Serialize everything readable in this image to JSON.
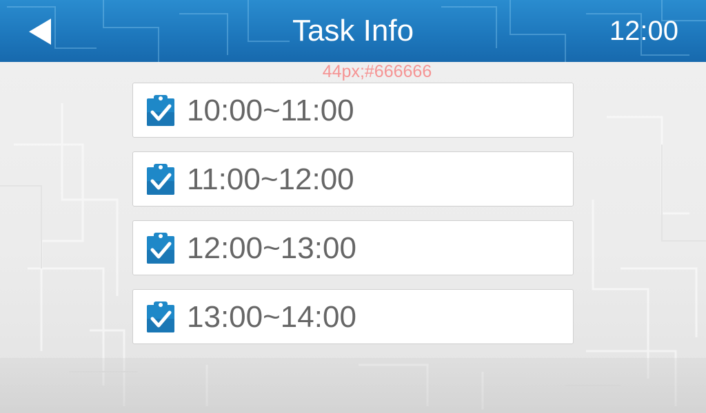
{
  "header": {
    "back_icon": "back-arrow-icon",
    "title": "Task Info",
    "clock": "12:00"
  },
  "annotation": "44px;#666666",
  "tasks": [
    {
      "label": "10:00~11:00",
      "icon": "clipboard-check-icon"
    },
    {
      "label": "11:00~12:00",
      "icon": "clipboard-check-icon"
    },
    {
      "label": "12:00~13:00",
      "icon": "clipboard-check-icon"
    },
    {
      "label": "13:00~14:00",
      "icon": "clipboard-check-icon"
    }
  ],
  "colors": {
    "header_blue": "#1e78bd",
    "text_gray": "#666666",
    "annotation_pink": "#f59494",
    "icon_blue": "#1e88c8"
  }
}
